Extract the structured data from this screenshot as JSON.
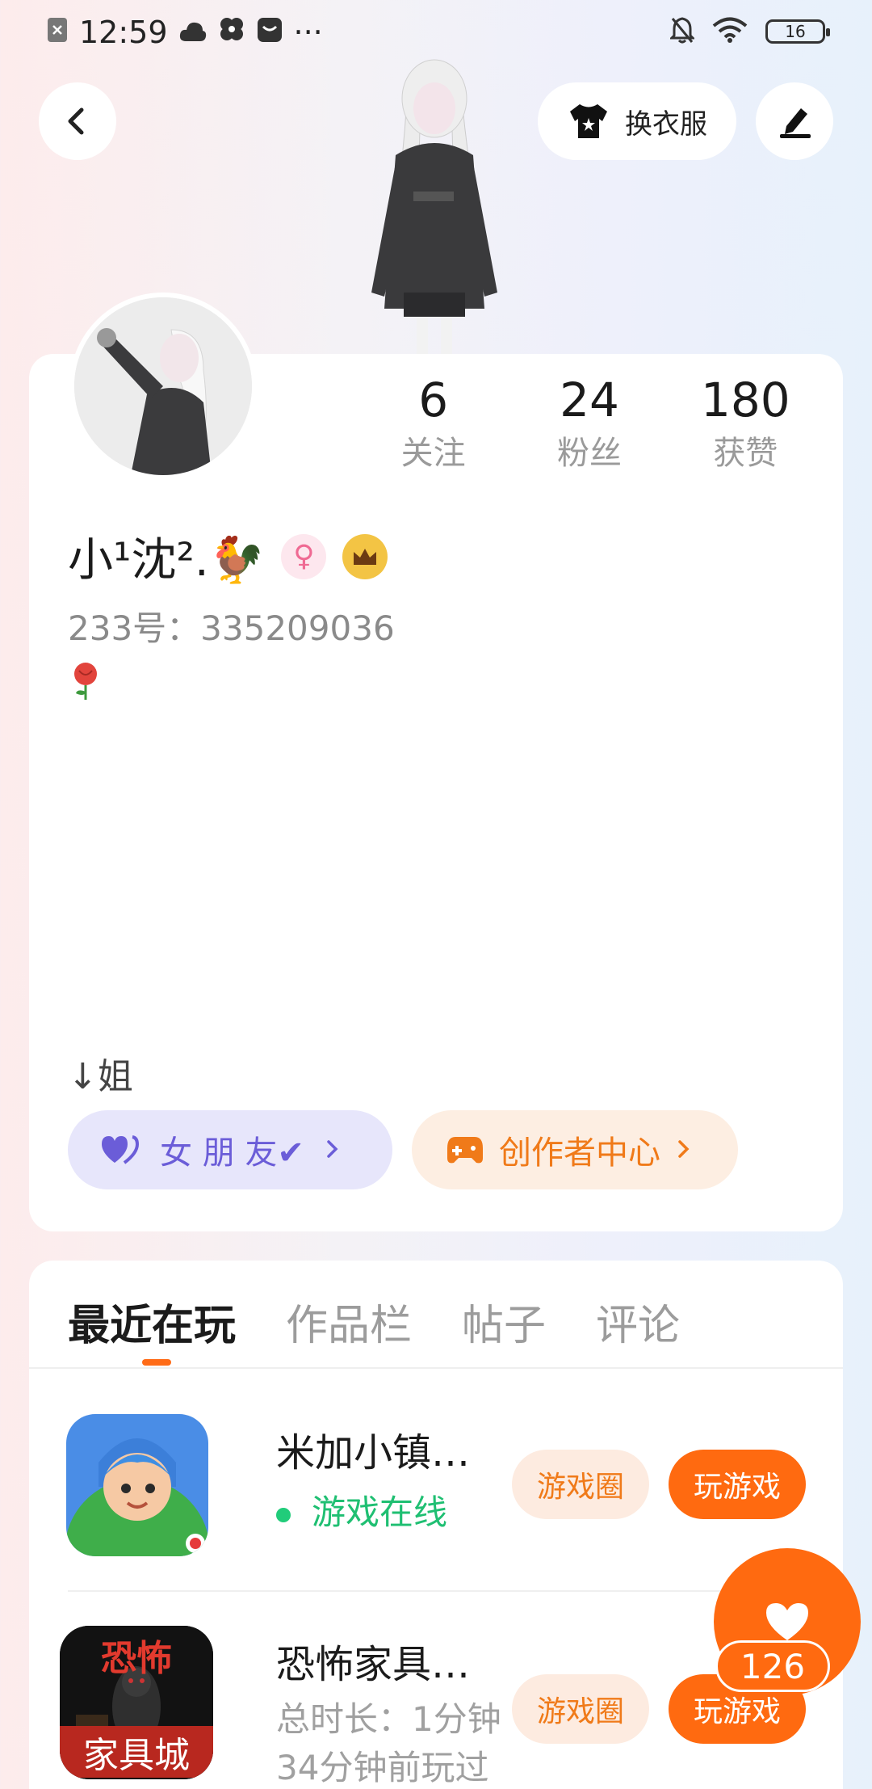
{
  "status_bar": {
    "time": "12:59",
    "more": "···",
    "battery": "16"
  },
  "header": {
    "outfit_label": "换衣服"
  },
  "profile": {
    "stats": [
      {
        "value": "6",
        "label": "关注"
      },
      {
        "value": "24",
        "label": "粉丝"
      },
      {
        "value": "180",
        "label": "获赞"
      }
    ],
    "name": "小¹沈².🐓",
    "uid": "233号：335209036",
    "emoji": "🌹",
    "bio": "↓姐",
    "tags": {
      "girlfriend": "女 朋 友✔",
      "creator": "创作者中心"
    }
  },
  "tabs": [
    {
      "label": "最近在玩",
      "active": true
    },
    {
      "label": "作品栏",
      "active": false
    },
    {
      "label": "帖子",
      "active": false
    },
    {
      "label": "评论",
      "active": false
    }
  ],
  "games": [
    {
      "title": "米加小镇…",
      "status": "游戏在线",
      "circle_label": "游戏圈",
      "play_label": "玩游戏"
    },
    {
      "title": "恐怖家具…",
      "duration": "总时长：1分钟",
      "last_played": "34分钟前玩过",
      "circle_label": "游戏圈",
      "play_label": "玩游戏",
      "icon_text_top": "恐怖",
      "icon_text_bottom": "家具城"
    }
  ],
  "likes": {
    "count": "126"
  },
  "colors": {
    "accent": "#ff6a10",
    "online": "#1fbf72",
    "purple": "#6b5dd8"
  }
}
